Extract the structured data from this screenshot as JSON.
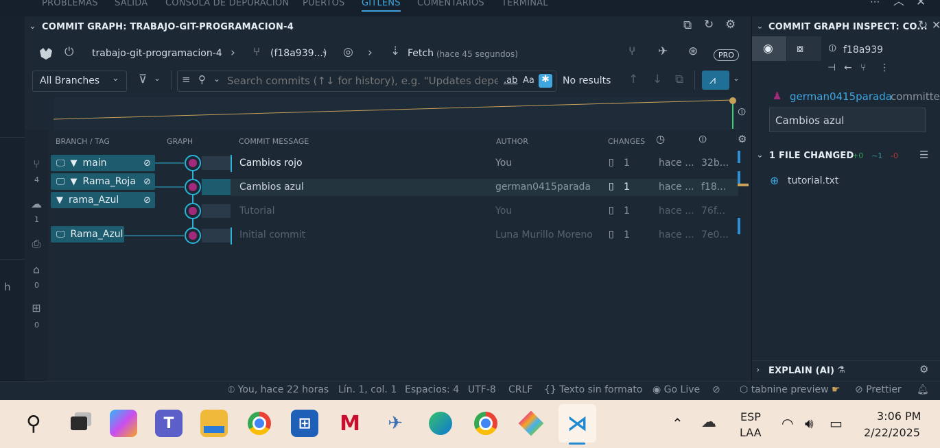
{
  "panel_tabs": [
    "PROBLEMAS",
    "SALIDA",
    "CONSOLA DE DEPURACIÓN",
    "PUERTOS",
    "GITLENS",
    "COMENTARIOS",
    "TERMINAL"
  ],
  "graph": {
    "title": "COMMIT GRAPH: TRABAJO-GIT-PROGRAMACION-4",
    "repo": "trabajo-git-programacion-4",
    "ref": "(f18a939...)",
    "fetch_label": "Fetch",
    "fetch_time": "(hace 45 segundos)",
    "pro_badge": "PRO",
    "branches_dropdown": "All Branches",
    "search_placeholder": "Search commits (↑↓ for history), e.g. \"Updates dependencies\" author:eamodio",
    "search_results": "No results",
    "regex_toggle": ".ab",
    "case_toggle": "Aa",
    "columns": {
      "branch": "BRANCH / TAG",
      "graph": "GRAPH",
      "message": "COMMIT MESSAGE",
      "author": "AUTHOR",
      "changes": "CHANGES"
    },
    "rows": [
      {
        "message": "Cambios rojo",
        "author": "You",
        "changes": "1",
        "date": "hace ...",
        "sha": "32b..."
      },
      {
        "message": "Cambios azul",
        "author": "german0415parada",
        "changes": "1",
        "date": "hace ...",
        "sha": "f18..."
      },
      {
        "message": "Tutorial",
        "author": "You",
        "changes": "1",
        "date": "hace ...",
        "sha": "76f..."
      },
      {
        "message": "Initial commit",
        "author": "Luna Murillo Moreno",
        "changes": "1",
        "date": "hace ...",
        "sha": "7e0..."
      }
    ],
    "branch_tags": [
      {
        "label": "main"
      },
      {
        "label": "Rama_Roja"
      },
      {
        "label": "rama_Azul"
      },
      {
        "label": "Rama_Azul"
      }
    ],
    "activity_counts": {
      "branches": "4",
      "remotes": "1",
      "tags": "0",
      "worktrees": "0"
    }
  },
  "inspect": {
    "title": "COMMIT GRAPH INSPECT: CO...",
    "sha": "f18a939",
    "author": "german0415parada",
    "verb": "committed",
    "message": "Cambios azul",
    "files_header": "1 FILE CHANGED",
    "stat_added": "+0",
    "stat_modified": "~1",
    "stat_deleted": "-0",
    "file": "tutorial.txt",
    "explain": "EXPLAIN (AI)"
  },
  "status": {
    "blame": "You, hace 22 horas",
    "position": "Lín. 1, col. 1",
    "spaces": "Espacios: 4",
    "encoding": "UTF-8",
    "eol": "CRLF",
    "language": "Texto sin formato",
    "golive": "Go Live",
    "tabnine": "tabnine preview",
    "prettier": "Prettier"
  },
  "taskbar": {
    "lang1": "ESP",
    "lang2": "LAA",
    "time": "3:06 PM",
    "date": "2/22/2025"
  },
  "colors": {
    "accent": "#3fa6e0",
    "tag_bg": "#1d5b6e",
    "node": "#a32a7a"
  }
}
